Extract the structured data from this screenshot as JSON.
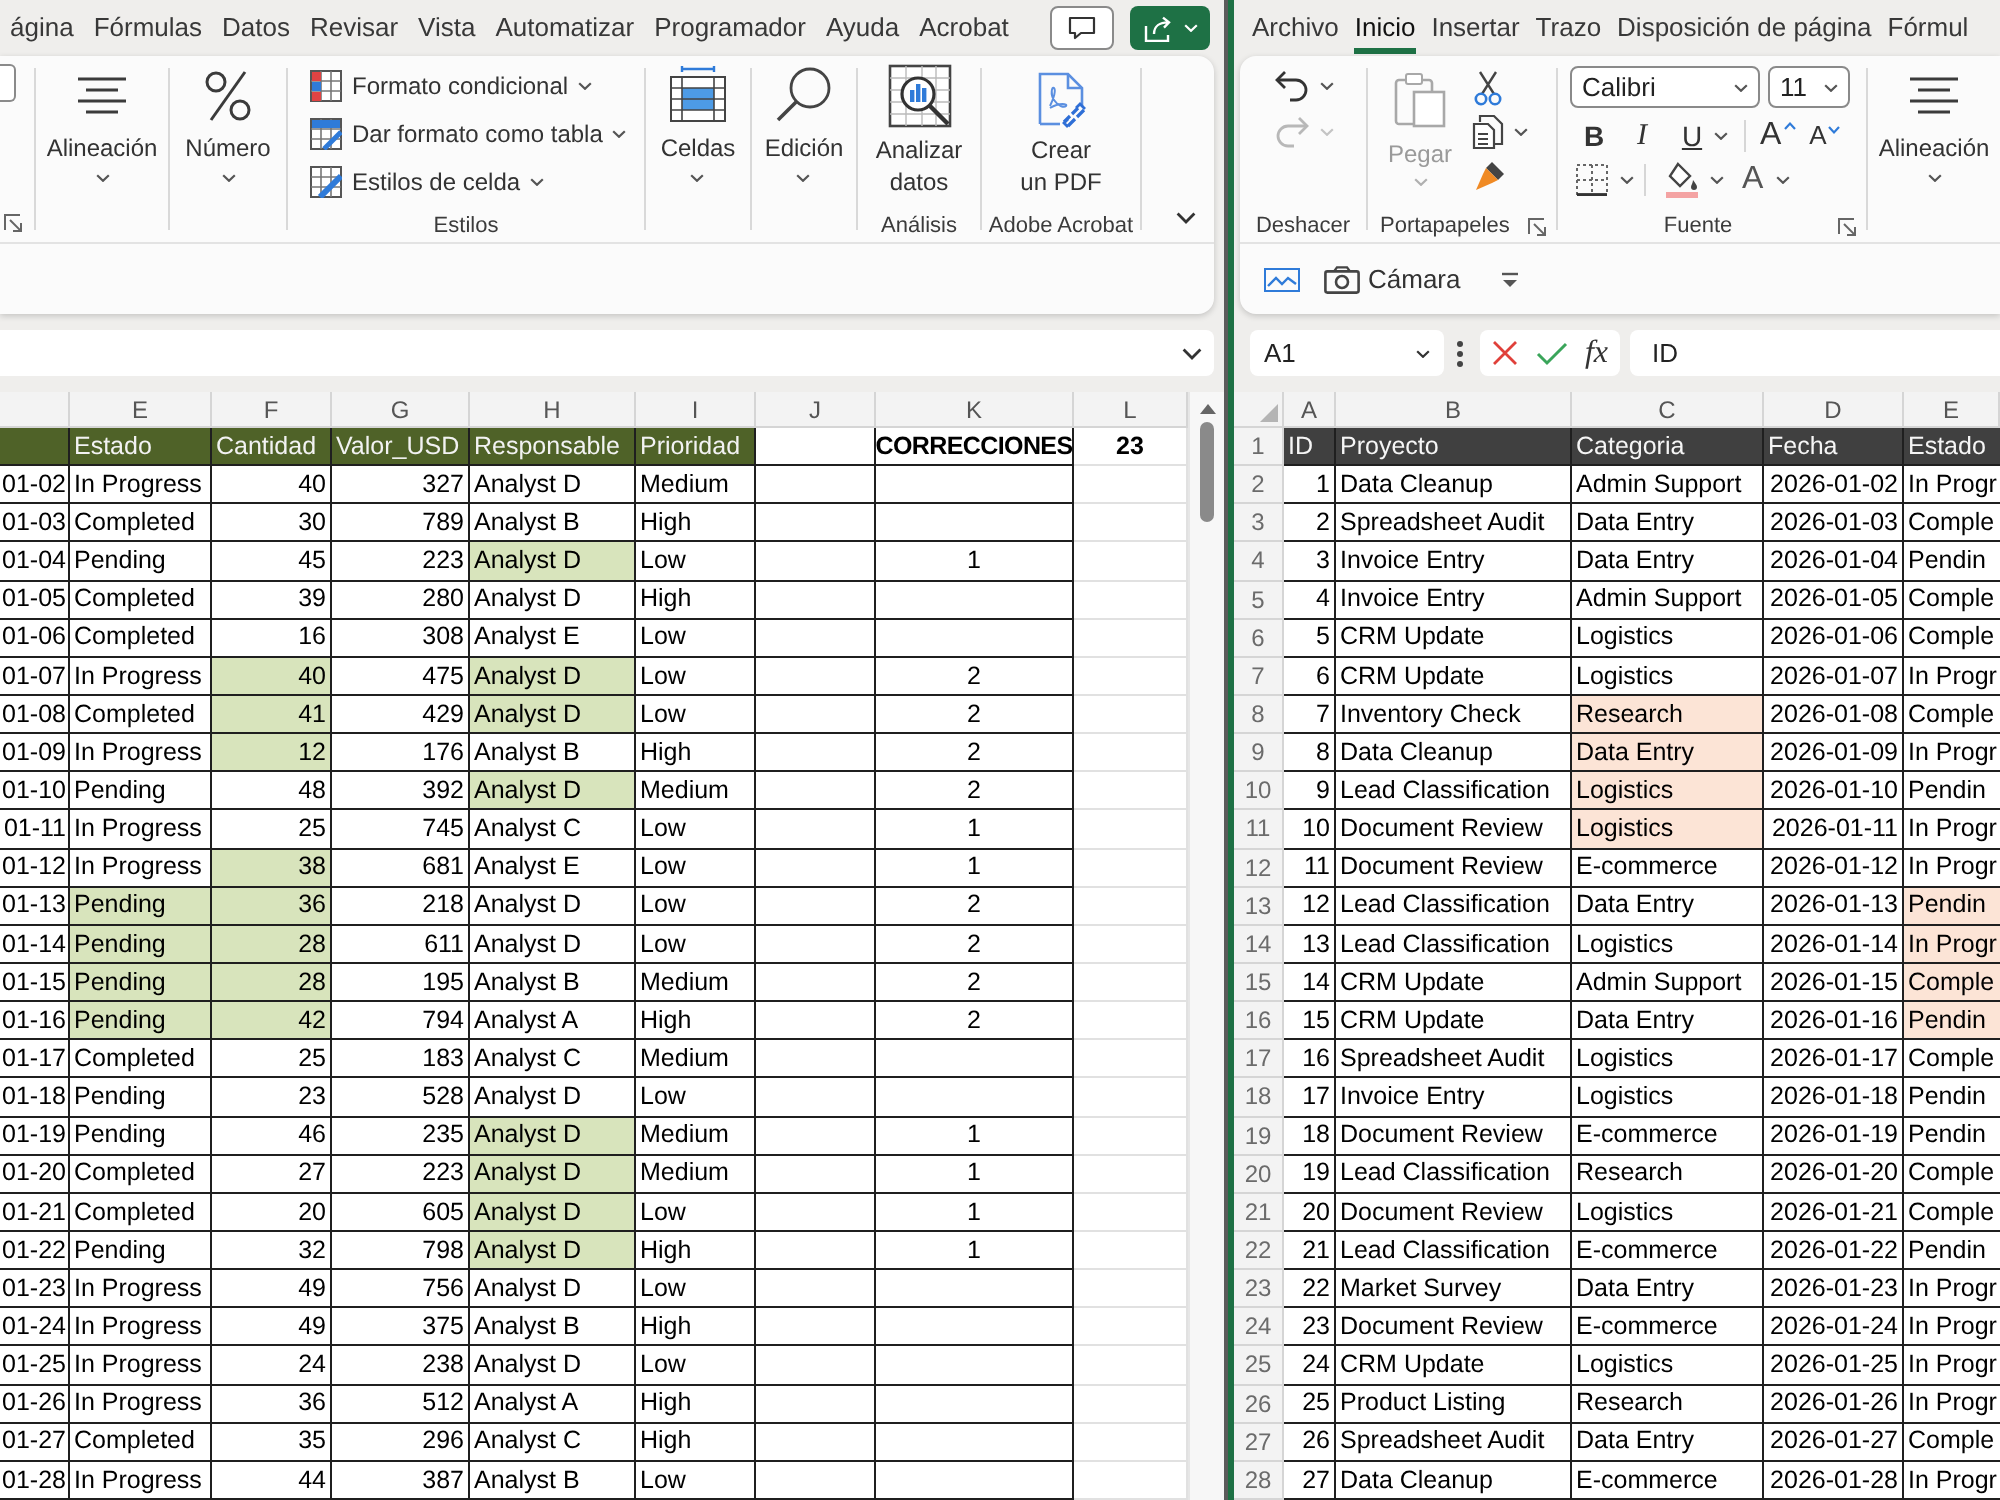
{
  "left_window": {
    "tabs": [
      {
        "label": "ágina",
        "selected": false
      },
      {
        "label": "Fórmulas",
        "selected": false
      },
      {
        "label": "Datos",
        "selected": false
      },
      {
        "label": "Revisar",
        "selected": false
      },
      {
        "label": "Vista",
        "selected": false
      },
      {
        "label": "Automatizar",
        "selected": false
      },
      {
        "label": "Programador",
        "selected": false
      },
      {
        "label": "Ayuda",
        "selected": false
      },
      {
        "label": "Acrobat",
        "selected": false
      }
    ],
    "ribbon": {
      "alignment": "Alineación",
      "number": "Número",
      "styles": {
        "items": [
          "Formato condicional",
          "Dar formato como tabla",
          "Estilos de celda"
        ],
        "group_label": "Estilos"
      },
      "cells": "Celdas",
      "editing": "Edición",
      "analysis": {
        "button": "Analizar datos",
        "group_label": "Análisis"
      },
      "acrobat": {
        "button": "Crear un PDF",
        "group_label": "Adobe Acrobat"
      }
    },
    "sheet": {
      "column_letters": [
        "E",
        "F",
        "G",
        "H",
        "I",
        "J",
        "K",
        "L"
      ],
      "header": [
        "Estado",
        "Cantidad",
        "Valor_USD",
        "Responsable",
        "Prioridad"
      ],
      "summary": {
        "label": "CORRECCIONES",
        "value": "23"
      },
      "rows": [
        {
          "cells": [
            "01-02",
            "In Progress",
            "40",
            "327",
            "Analyst D",
            "Medium"
          ],
          "highlighted": [
            false,
            false,
            false,
            false,
            false,
            false
          ]
        },
        {
          "cells": [
            "01-03",
            "Completed",
            "30",
            "789",
            "Analyst B",
            "High"
          ],
          "highlighted": [
            false,
            false,
            false,
            false,
            false,
            false
          ]
        },
        {
          "cells": [
            "01-04",
            "Pending",
            "45",
            "223",
            "Analyst D",
            "Low"
          ],
          "highlighted": [
            false,
            false,
            false,
            false,
            true,
            false
          ],
          "corrections": "1"
        },
        {
          "cells": [
            "01-05",
            "Completed",
            "39",
            "280",
            "Analyst D",
            "High"
          ],
          "highlighted": [
            false,
            false,
            false,
            false,
            false,
            false
          ]
        },
        {
          "cells": [
            "01-06",
            "Completed",
            "16",
            "308",
            "Analyst E",
            "Low"
          ],
          "highlighted": [
            false,
            false,
            false,
            false,
            false,
            false
          ]
        },
        {
          "cells": [
            "01-07",
            "In Progress",
            "40",
            "475",
            "Analyst D",
            "Low"
          ],
          "highlighted": [
            false,
            false,
            true,
            false,
            true,
            false
          ],
          "corrections": "2"
        },
        {
          "cells": [
            "01-08",
            "Completed",
            "41",
            "429",
            "Analyst D",
            "Low"
          ],
          "highlighted": [
            false,
            false,
            true,
            false,
            true,
            false
          ],
          "corrections": "2"
        },
        {
          "cells": [
            "01-09",
            "In Progress",
            "12",
            "176",
            "Analyst B",
            "High"
          ],
          "highlighted": [
            false,
            false,
            true,
            false,
            false,
            false
          ],
          "corrections": "2"
        },
        {
          "cells": [
            "01-10",
            "Pending",
            "48",
            "392",
            "Analyst D",
            "Medium"
          ],
          "highlighted": [
            false,
            false,
            false,
            false,
            true,
            false
          ],
          "corrections": "2"
        },
        {
          "cells": [
            "01-11",
            "In Progress",
            "25",
            "745",
            "Analyst C",
            "Low"
          ],
          "highlighted": [
            false,
            false,
            false,
            false,
            false,
            false
          ],
          "corrections": "1"
        },
        {
          "cells": [
            "01-12",
            "In Progress",
            "38",
            "681",
            "Analyst E",
            "Low"
          ],
          "highlighted": [
            false,
            false,
            true,
            false,
            false,
            false
          ],
          "corrections": "1"
        },
        {
          "cells": [
            "01-13",
            "Pending",
            "36",
            "218",
            "Analyst D",
            "Low"
          ],
          "highlighted": [
            false,
            true,
            true,
            false,
            false,
            false
          ],
          "corrections": "2"
        },
        {
          "cells": [
            "01-14",
            "Pending",
            "28",
            "611",
            "Analyst D",
            "Low"
          ],
          "highlighted": [
            false,
            true,
            true,
            false,
            false,
            false
          ],
          "corrections": "2"
        },
        {
          "cells": [
            "01-15",
            "Pending",
            "28",
            "195",
            "Analyst B",
            "Medium"
          ],
          "highlighted": [
            false,
            true,
            true,
            false,
            false,
            false
          ],
          "corrections": "2"
        },
        {
          "cells": [
            "01-16",
            "Pending",
            "42",
            "794",
            "Analyst A",
            "High"
          ],
          "highlighted": [
            false,
            true,
            true,
            false,
            false,
            false
          ],
          "corrections": "2"
        },
        {
          "cells": [
            "01-17",
            "Completed",
            "25",
            "183",
            "Analyst C",
            "Medium"
          ],
          "highlighted": [
            false,
            false,
            false,
            false,
            false,
            false
          ]
        },
        {
          "cells": [
            "01-18",
            "Pending",
            "23",
            "528",
            "Analyst D",
            "Low"
          ],
          "highlighted": [
            false,
            false,
            false,
            false,
            false,
            false
          ]
        },
        {
          "cells": [
            "01-19",
            "Pending",
            "46",
            "235",
            "Analyst D",
            "Medium"
          ],
          "highlighted": [
            false,
            false,
            false,
            false,
            true,
            false
          ],
          "corrections": "1"
        },
        {
          "cells": [
            "01-20",
            "Completed",
            "27",
            "223",
            "Analyst D",
            "Medium"
          ],
          "highlighted": [
            false,
            false,
            false,
            false,
            true,
            false
          ],
          "corrections": "1"
        },
        {
          "cells": [
            "01-21",
            "Completed",
            "20",
            "605",
            "Analyst D",
            "Low"
          ],
          "highlighted": [
            false,
            false,
            false,
            false,
            true,
            false
          ],
          "corrections": "1"
        },
        {
          "cells": [
            "01-22",
            "Pending",
            "32",
            "798",
            "Analyst D",
            "High"
          ],
          "highlighted": [
            false,
            false,
            false,
            false,
            true,
            false
          ],
          "corrections": "1"
        },
        {
          "cells": [
            "01-23",
            "In Progress",
            "49",
            "756",
            "Analyst D",
            "Low"
          ],
          "highlighted": [
            false,
            false,
            false,
            false,
            false,
            false
          ]
        },
        {
          "cells": [
            "01-24",
            "In Progress",
            "49",
            "375",
            "Analyst B",
            "High"
          ],
          "highlighted": [
            false,
            false,
            false,
            false,
            false,
            false
          ]
        },
        {
          "cells": [
            "01-25",
            "In Progress",
            "24",
            "238",
            "Analyst D",
            "Low"
          ],
          "highlighted": [
            false,
            false,
            false,
            false,
            false,
            false
          ]
        },
        {
          "cells": [
            "01-26",
            "In Progress",
            "36",
            "512",
            "Analyst A",
            "High"
          ],
          "highlighted": [
            false,
            false,
            false,
            false,
            false,
            false
          ]
        },
        {
          "cells": [
            "01-27",
            "Completed",
            "35",
            "296",
            "Analyst C",
            "High"
          ],
          "highlighted": [
            false,
            false,
            false,
            false,
            false,
            false
          ]
        },
        {
          "cells": [
            "01-28",
            "In Progress",
            "44",
            "387",
            "Analyst B",
            "Low"
          ],
          "highlighted": [
            false,
            false,
            false,
            false,
            false,
            false
          ]
        }
      ]
    }
  },
  "right_window": {
    "tabs": [
      {
        "label": "Archivo",
        "selected": false
      },
      {
        "label": "Inicio",
        "selected": true
      },
      {
        "label": "Insertar",
        "selected": false
      },
      {
        "label": "Trazo",
        "selected": false
      },
      {
        "label": "Disposición de página",
        "selected": false
      },
      {
        "label": "Fórmul",
        "selected": false
      }
    ],
    "ribbon": {
      "undo": {
        "group_label": "Deshacer",
        "redo_disabled": true
      },
      "clipboard": {
        "paste": {
          "label": "Pegar",
          "disabled": true
        },
        "group_label": "Portapapeles"
      },
      "font": {
        "name": "Calibri",
        "size": "11",
        "styles": [
          "B",
          "I",
          "U"
        ],
        "size_buttons": [
          "A",
          "A"
        ],
        "color_button": "A",
        "group_label": "Fuente"
      },
      "alignment": "Alineación"
    },
    "quick_toolbar": {
      "camera": "Cámara"
    },
    "formula_bar": {
      "name_box": "A1",
      "function_button": "fx",
      "value": "ID"
    },
    "sheet": {
      "column_letters": [
        "A",
        "B",
        "C",
        "D",
        "E"
      ],
      "rows": [
        {
          "kind": "header",
          "number": "1",
          "cells": [
            "ID",
            "Proyecto",
            "Categoria",
            "Fecha",
            "Estado"
          ]
        },
        {
          "kind": "data",
          "number": "2",
          "cells": [
            "1",
            "Data Cleanup",
            "Admin Support",
            "2026-01-02",
            "In Progr"
          ],
          "highlighted": [
            false,
            false,
            false,
            false,
            false
          ]
        },
        {
          "kind": "data",
          "number": "3",
          "cells": [
            "2",
            "Spreadsheet Audit",
            "Data Entry",
            "2026-01-03",
            "Comple"
          ],
          "highlighted": [
            false,
            false,
            false,
            false,
            false
          ]
        },
        {
          "kind": "data",
          "number": "4",
          "cells": [
            "3",
            "Invoice Entry",
            "Data Entry",
            "2026-01-04",
            "Pendin"
          ],
          "highlighted": [
            false,
            false,
            false,
            false,
            false
          ]
        },
        {
          "kind": "data",
          "number": "5",
          "cells": [
            "4",
            "Invoice Entry",
            "Admin Support",
            "2026-01-05",
            "Comple"
          ],
          "highlighted": [
            false,
            false,
            false,
            false,
            false
          ]
        },
        {
          "kind": "data",
          "number": "6",
          "cells": [
            "5",
            "CRM Update",
            "Logistics",
            "2026-01-06",
            "Comple"
          ],
          "highlighted": [
            false,
            false,
            false,
            false,
            false
          ]
        },
        {
          "kind": "data",
          "number": "7",
          "cells": [
            "6",
            "CRM Update",
            "Logistics",
            "2026-01-07",
            "In Progr"
          ],
          "highlighted": [
            false,
            false,
            false,
            false,
            false
          ]
        },
        {
          "kind": "data",
          "number": "8",
          "cells": [
            "7",
            "Inventory Check",
            "Research",
            "2026-01-08",
            "Comple"
          ],
          "highlighted": [
            false,
            false,
            true,
            false,
            false
          ]
        },
        {
          "kind": "data",
          "number": "9",
          "cells": [
            "8",
            "Data Cleanup",
            "Data Entry",
            "2026-01-09",
            "In Progr"
          ],
          "highlighted": [
            false,
            false,
            true,
            false,
            false
          ]
        },
        {
          "kind": "data",
          "number": "10",
          "cells": [
            "9",
            "Lead Classification",
            "Logistics",
            "2026-01-10",
            "Pendin"
          ],
          "highlighted": [
            false,
            false,
            true,
            false,
            false
          ]
        },
        {
          "kind": "data",
          "number": "11",
          "cells": [
            "10",
            "Document Review",
            "Logistics",
            "2026-01-11",
            "In Progr"
          ],
          "highlighted": [
            false,
            false,
            true,
            false,
            false
          ]
        },
        {
          "kind": "data",
          "number": "12",
          "cells": [
            "11",
            "Document Review",
            "E-commerce",
            "2026-01-12",
            "In Progr"
          ],
          "highlighted": [
            false,
            false,
            false,
            false,
            false
          ]
        },
        {
          "kind": "data",
          "number": "13",
          "cells": [
            "12",
            "Lead Classification",
            "Data Entry",
            "2026-01-13",
            "Pendin"
          ],
          "highlighted": [
            false,
            false,
            false,
            false,
            true
          ]
        },
        {
          "kind": "data",
          "number": "14",
          "cells": [
            "13",
            "Lead Classification",
            "Logistics",
            "2026-01-14",
            "In Progr"
          ],
          "highlighted": [
            false,
            false,
            false,
            false,
            true
          ]
        },
        {
          "kind": "data",
          "number": "15",
          "cells": [
            "14",
            "CRM Update",
            "Admin Support",
            "2026-01-15",
            "Comple"
          ],
          "highlighted": [
            false,
            false,
            false,
            false,
            true
          ]
        },
        {
          "kind": "data",
          "number": "16",
          "cells": [
            "15",
            "CRM Update",
            "Data Entry",
            "2026-01-16",
            "Pendin"
          ],
          "highlighted": [
            false,
            false,
            false,
            false,
            true
          ]
        },
        {
          "kind": "data",
          "number": "17",
          "cells": [
            "16",
            "Spreadsheet Audit",
            "Logistics",
            "2026-01-17",
            "Comple"
          ],
          "highlighted": [
            false,
            false,
            false,
            false,
            false
          ]
        },
        {
          "kind": "data",
          "number": "18",
          "cells": [
            "17",
            "Invoice Entry",
            "Logistics",
            "2026-01-18",
            "Pendin"
          ],
          "highlighted": [
            false,
            false,
            false,
            false,
            false
          ]
        },
        {
          "kind": "data",
          "number": "19",
          "cells": [
            "18",
            "Document Review",
            "E-commerce",
            "2026-01-19",
            "Pendin"
          ],
          "highlighted": [
            false,
            false,
            false,
            false,
            false
          ]
        },
        {
          "kind": "data",
          "number": "20",
          "cells": [
            "19",
            "Lead Classification",
            "Research",
            "2026-01-20",
            "Comple"
          ],
          "highlighted": [
            false,
            false,
            false,
            false,
            false
          ]
        },
        {
          "kind": "data",
          "number": "21",
          "cells": [
            "20",
            "Document Review",
            "Logistics",
            "2026-01-21",
            "Comple"
          ],
          "highlighted": [
            false,
            false,
            false,
            false,
            false
          ]
        },
        {
          "kind": "data",
          "number": "22",
          "cells": [
            "21",
            "Lead Classification",
            "E-commerce",
            "2026-01-22",
            "Pendin"
          ],
          "highlighted": [
            false,
            false,
            false,
            false,
            false
          ]
        },
        {
          "kind": "data",
          "number": "23",
          "cells": [
            "22",
            "Market Survey",
            "Data Entry",
            "2026-01-23",
            "In Progr"
          ],
          "highlighted": [
            false,
            false,
            false,
            false,
            false
          ]
        },
        {
          "kind": "data",
          "number": "24",
          "cells": [
            "23",
            "Document Review",
            "E-commerce",
            "2026-01-24",
            "In Progr"
          ],
          "highlighted": [
            false,
            false,
            false,
            false,
            false
          ]
        },
        {
          "kind": "data",
          "number": "25",
          "cells": [
            "24",
            "CRM Update",
            "Logistics",
            "2026-01-25",
            "In Progr"
          ],
          "highlighted": [
            false,
            false,
            false,
            false,
            false
          ]
        },
        {
          "kind": "data",
          "number": "26",
          "cells": [
            "25",
            "Product Listing",
            "Research",
            "2026-01-26",
            "In Progr"
          ],
          "highlighted": [
            false,
            false,
            false,
            false,
            false
          ]
        },
        {
          "kind": "data",
          "number": "27",
          "cells": [
            "26",
            "Spreadsheet Audit",
            "Data Entry",
            "2026-01-27",
            "Comple"
          ],
          "highlighted": [
            false,
            false,
            false,
            false,
            false
          ]
        },
        {
          "kind": "data",
          "number": "28",
          "cells": [
            "27",
            "Data Cleanup",
            "E-commerce",
            "2026-01-28",
            "In Progr"
          ],
          "highlighted": [
            false,
            false,
            false,
            false,
            false
          ]
        }
      ]
    }
  }
}
